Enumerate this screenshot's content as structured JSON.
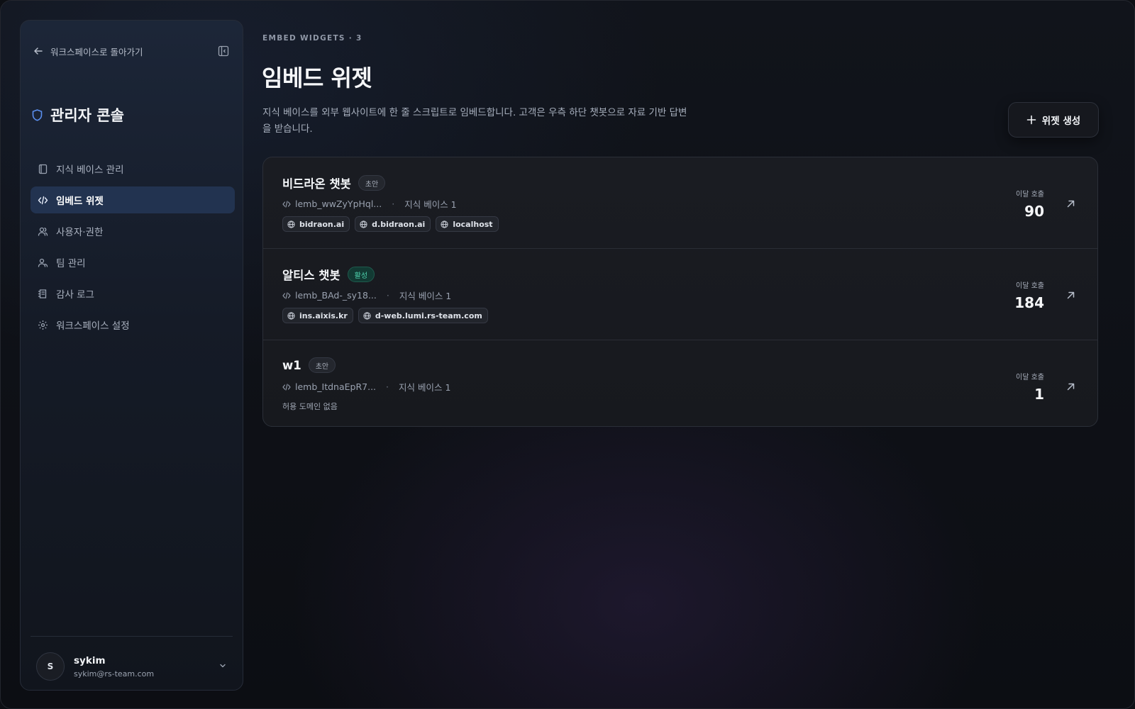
{
  "sidebar": {
    "back_label": "워크스페이스로 돌아가기",
    "console_title": "관리자 콘솔",
    "items": [
      {
        "label": "지식 베이스 관리",
        "icon": "book-icon",
        "active": false
      },
      {
        "label": "임베드 위젯",
        "icon": "code-icon",
        "active": true
      },
      {
        "label": "사용자·권한",
        "icon": "users-icon",
        "active": false
      },
      {
        "label": "팀 관리",
        "icon": "team-icon",
        "active": false
      },
      {
        "label": "감사 로그",
        "icon": "log-icon",
        "active": false
      },
      {
        "label": "워크스페이스 설정",
        "icon": "gear-icon",
        "active": false
      }
    ],
    "user": {
      "initial": "S",
      "name": "sykim",
      "email": "sykim@rs-team.com"
    }
  },
  "header": {
    "eyebrow": "EMBED WIDGETS · 3",
    "title": "임베드 위젯",
    "description": "지식 베이스를 외부 웹사이트에 한 줄 스크립트로 임베드합니다. 고객은 우측 하단 챗봇으로 자료 기반 답변을 받습니다.",
    "create_label": "위젯 생성"
  },
  "widgets": [
    {
      "name": "비드라온 챗봇",
      "status": "초안",
      "status_kind": "draft",
      "key": "lemb_wwZyYpHql...",
      "kb": "지식 베이스 1",
      "domains": [
        "bidraon.ai",
        "d.bidraon.ai",
        "localhost"
      ],
      "calls_label": "이달 호출",
      "calls": "90"
    },
    {
      "name": "알티스 챗봇",
      "status": "활성",
      "status_kind": "active",
      "key": "lemb_BAd-_sy18...",
      "kb": "지식 베이스 1",
      "domains": [
        "ins.aixis.kr",
        "d-web.lumi.rs-team.com"
      ],
      "calls_label": "이달 호출",
      "calls": "184"
    },
    {
      "name": "w1",
      "status": "초안",
      "status_kind": "draft",
      "key": "lemb_ItdnaEpR7...",
      "kb": "지식 베이스 1",
      "domains": [],
      "no_domain_text": "허용 도메인 없음",
      "calls_label": "이달 호출",
      "calls": "1"
    }
  ],
  "colors": {
    "accent": "#5b8ff0",
    "active_nav_bg": "#223350",
    "active_badge": "#4ed3ae"
  }
}
